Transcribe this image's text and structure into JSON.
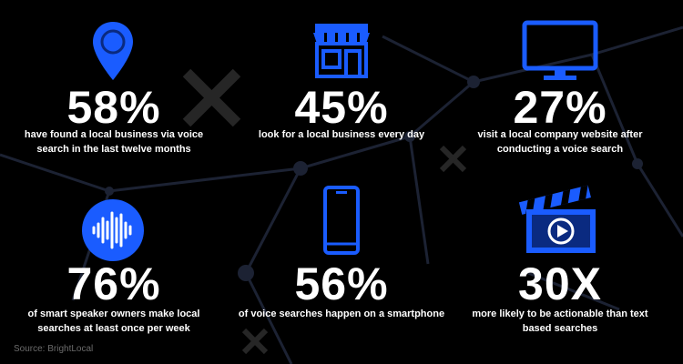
{
  "colors": {
    "accent": "#1a5cff",
    "background": "#000000",
    "text": "#ffffff",
    "source": "#6b6b6b"
  },
  "stats": [
    {
      "icon": "location-pin-icon",
      "value": "58%",
      "description": "have found a local business via voice search in the last twelve months"
    },
    {
      "icon": "storefront-icon",
      "value": "45%",
      "description": "look for a local business every day"
    },
    {
      "icon": "monitor-icon",
      "value": "27%",
      "description": "visit a local company website after conducting a voice search"
    },
    {
      "icon": "sound-wave-icon",
      "value": "76%",
      "description": "of smart speaker owners make local searches at least once per week"
    },
    {
      "icon": "smartphone-icon",
      "value": "56%",
      "description": "of voice searches happen on a smartphone"
    },
    {
      "icon": "video-clapperboard-icon",
      "value": "30X",
      "description": "more likely to be actionable than text based searches"
    }
  ],
  "source": "Source: BrightLocal"
}
